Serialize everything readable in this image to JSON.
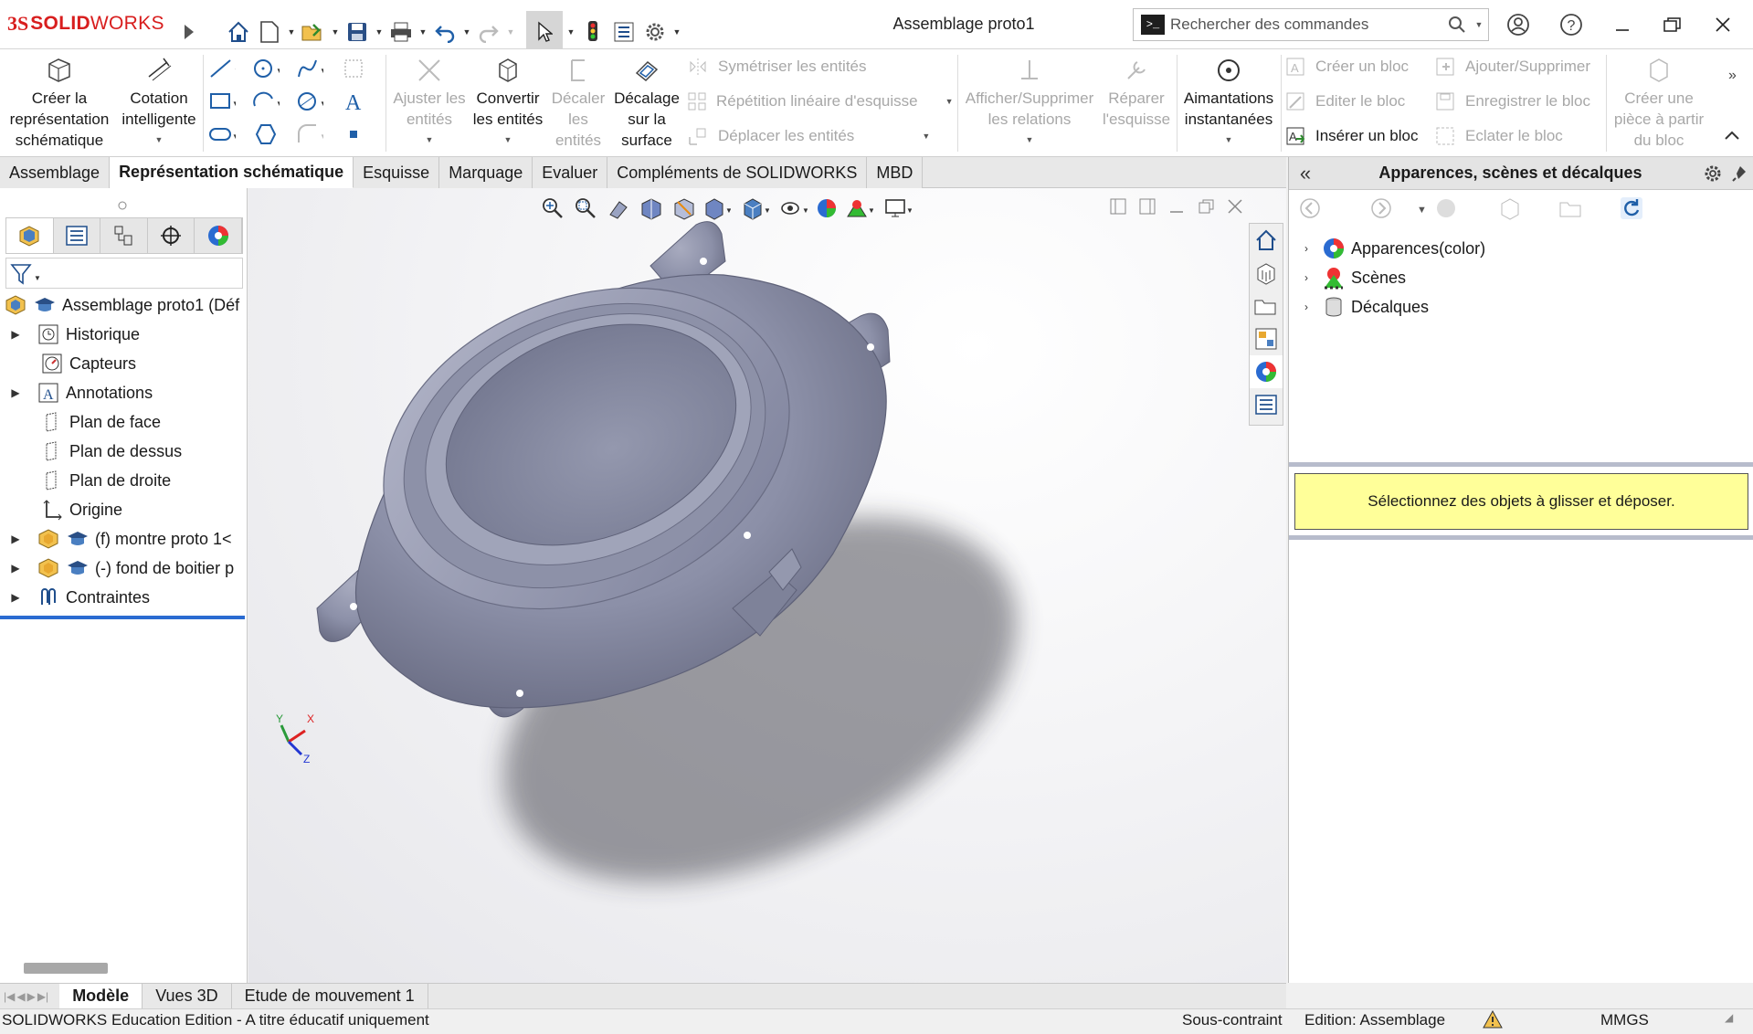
{
  "app": {
    "logo_prefix": "3S",
    "logo_solid": "SOLID",
    "logo_works": "WORKS",
    "window_title": "Assemblage proto1",
    "search_placeholder": "Rechercher des commandes"
  },
  "ribbon": {
    "schematic": "Créer la représentation schématique",
    "smart_dim": "Cotation intelligente",
    "trim": "Ajuster les entités",
    "convert": "Convertir les entités",
    "offset": "Décaler les entités",
    "offset_surface": "Décalage sur la surface",
    "mirror": "Symétriser les entités",
    "linear_pattern": "Répétition linéaire d'esquisse",
    "move": "Déplacer les entités",
    "relations": "Afficher/Supprimer les relations",
    "repair": "Réparer l'esquisse",
    "snaps": "Aimantations instantanées",
    "make_block": "Créer un bloc",
    "edit_block": "Editer le bloc",
    "insert_block": "Insérer un bloc",
    "add_remove": "Ajouter/Supprimer",
    "save_block": "Enregistrer le bloc",
    "explode_block": "Eclater le bloc",
    "part_from_block": "Créer une pièce à partir du bloc"
  },
  "tabs": [
    "Assemblage",
    "Représentation schématique",
    "Esquisse",
    "Marquage",
    "Evaluer",
    "Compléments de SOLIDWORKS",
    "MBD"
  ],
  "active_tab": "Représentation schématique",
  "tree": {
    "root": "Assemblage proto1 (Déf",
    "items": [
      "Historique",
      "Capteurs",
      "Annotations",
      "Plan de face",
      "Plan de dessus",
      "Plan de droite",
      "Origine",
      "(f) montre proto 1<",
      "(-) fond de boitier p",
      "Contraintes"
    ]
  },
  "triad": {
    "x": "X",
    "y": "Y",
    "z": "Z"
  },
  "taskpane": {
    "title": "Apparences, scènes et décalques",
    "items": [
      "Apparences(color)",
      "Scènes",
      "Décalques"
    ],
    "message": "Sélectionnez des objets à glisser et déposer."
  },
  "bottom_tabs": [
    "Modèle",
    "Vues 3D",
    "Etude de mouvement 1"
  ],
  "status": {
    "edition": "SOLIDWORKS Education Edition - A titre éducatif uniquement",
    "constraint": "Sous-contraint",
    "mode": "Edition: Assemblage",
    "units": "MMGS"
  },
  "colors": {
    "brand": "#d81e1e",
    "model": "#8c90a8",
    "message_bg": "#ffff99",
    "accent": "#1f5fa8"
  }
}
